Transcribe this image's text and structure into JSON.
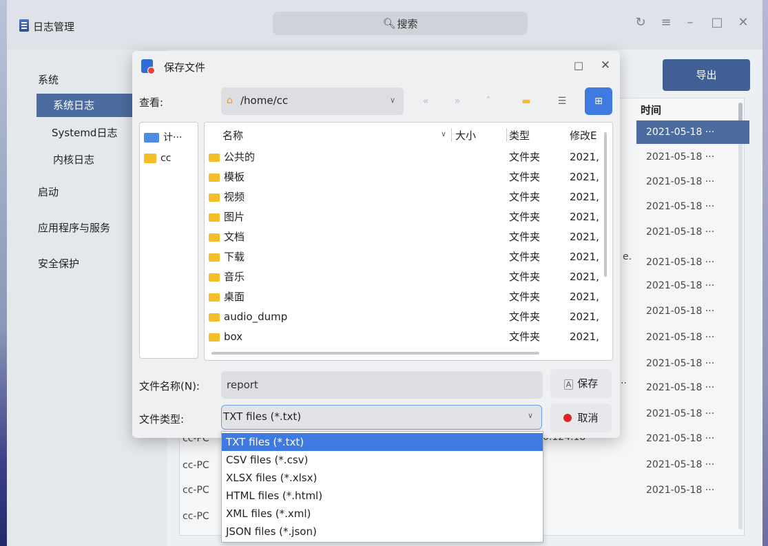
{
  "app": {
    "title": "日志管理",
    "search_placeholder": "搜索",
    "window_controls": [
      "refresh-icon",
      "menu-icon",
      "minimize-icon",
      "maximize-icon",
      "close-icon"
    ]
  },
  "sidebar": {
    "items": [
      {
        "label": "系统"
      },
      {
        "label": "系统日志",
        "selected": true
      },
      {
        "label": "Systemd日志"
      },
      {
        "label": "内核日志"
      },
      {
        "label": "启动"
      },
      {
        "label": "应用程序与服务"
      },
      {
        "label": "安全保护"
      }
    ]
  },
  "main": {
    "export_label": "导出",
    "time_header": "时间",
    "times": [
      "2021-05-18 ···",
      "2021-05-18 ···",
      "2021-05-18 ···",
      "2021-05-18 ···",
      "2021-05-18 ···",
      "2021-05-18 ···",
      "2021-05-18 ···",
      "2021-05-18 ···",
      "2021-05-18 ···",
      "2021-05-18 ···",
      "2021-05-18 ···",
      "2021-05-18 ···",
      "2021-05-18 ···",
      "2021-05-18 ···",
      "2021-05-18 ···"
    ],
    "hosts": [
      "cc-PC",
      "cc-PC",
      "cc-PC",
      "cc-PC"
    ],
    "partial_texts": [
      "e.",
      "··",
      "0.124.18"
    ]
  },
  "dialog": {
    "title": "保存文件",
    "look_in_label": "查看:",
    "path": "/home/cc",
    "places": [
      {
        "label": "计···",
        "icon": "computer-icon"
      },
      {
        "label": "cc",
        "icon": "home-folder-icon"
      }
    ],
    "columns": {
      "name": "名称",
      "size": "大小",
      "type": "类型",
      "modified": "修改E"
    },
    "files": [
      {
        "name": "公共的",
        "type": "文件夹",
        "date": "2021,"
      },
      {
        "name": "模板",
        "type": "文件夹",
        "date": "2021,"
      },
      {
        "name": "视频",
        "type": "文件夹",
        "date": "2021,"
      },
      {
        "name": "图片",
        "type": "文件夹",
        "date": "2021,"
      },
      {
        "name": "文档",
        "type": "文件夹",
        "date": "2021,"
      },
      {
        "name": "下载",
        "type": "文件夹",
        "date": "2021,"
      },
      {
        "name": "音乐",
        "type": "文件夹",
        "date": "2021,"
      },
      {
        "name": "桌面",
        "type": "文件夹",
        "date": "2021,"
      },
      {
        "name": "audio_dump",
        "type": "文件夹",
        "date": "2021,"
      },
      {
        "name": "box",
        "type": "文件夹",
        "date": "2021,"
      }
    ],
    "filename_label": "文件名称(N):",
    "filename_value": "report",
    "filetype_label": "文件类型:",
    "filetype_value": "TXT files (*.txt)",
    "save_label": "保存",
    "cancel_label": "取消",
    "filetype_options": [
      "TXT files (*.txt)",
      "CSV files (*.csv)",
      "XLSX files (*.xlsx)",
      "HTML files (*.html)",
      "XML files (*.xml)",
      "JSON files (*.json)"
    ],
    "filetype_selected_index": 0
  }
}
